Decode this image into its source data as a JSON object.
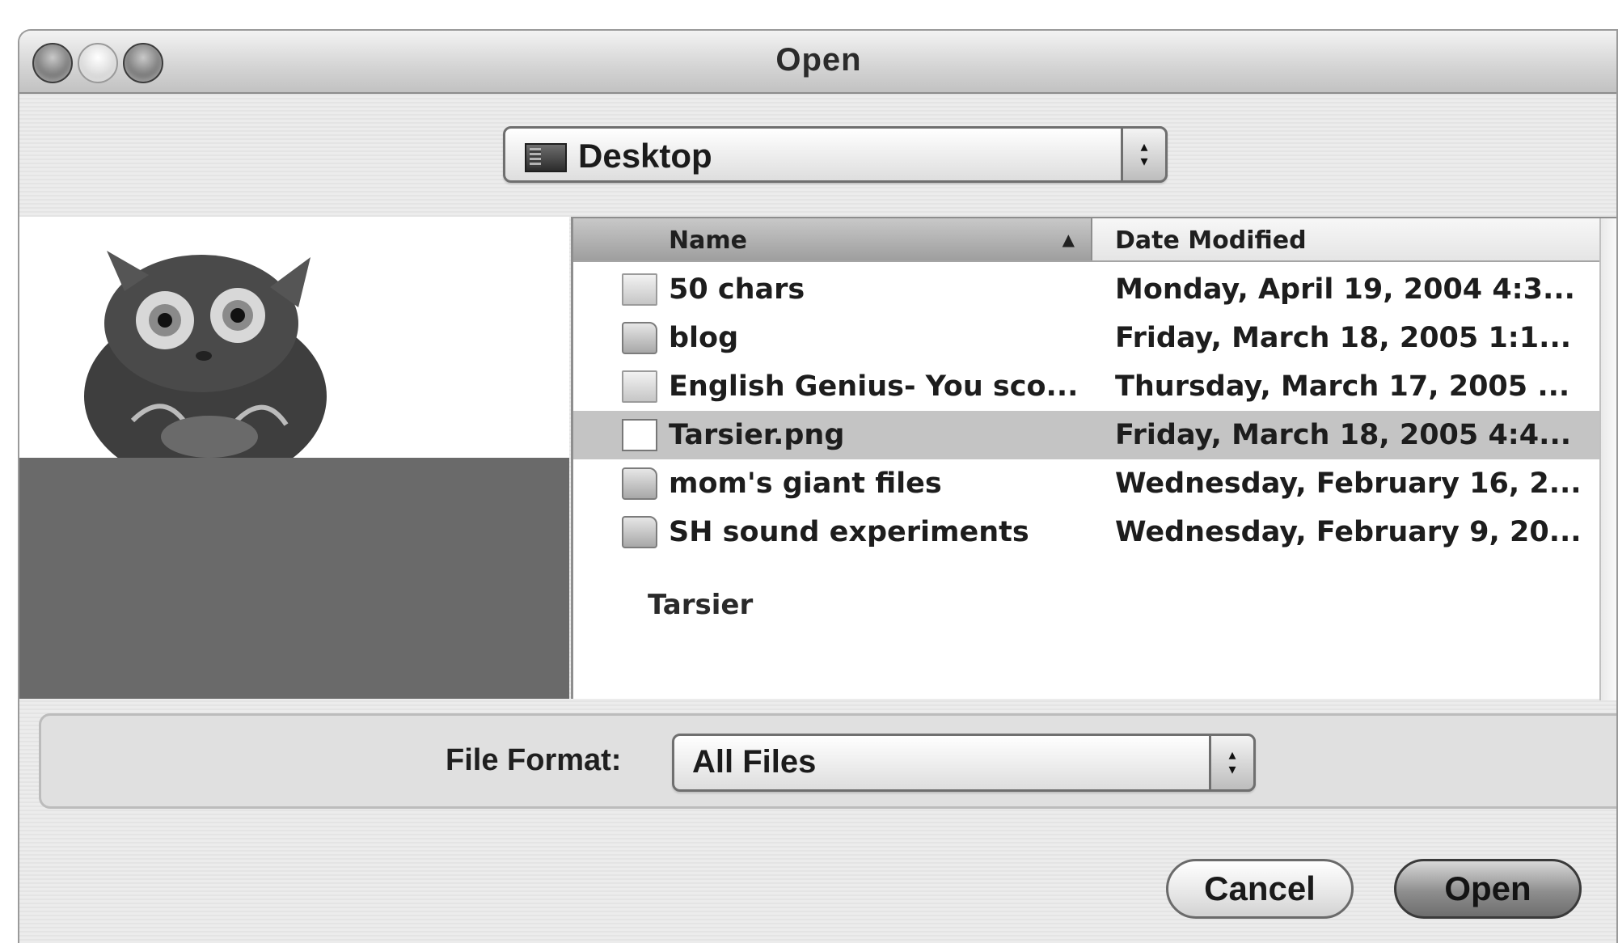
{
  "window": {
    "title": "Open",
    "controls": [
      "close",
      "minimize",
      "zoom"
    ]
  },
  "location": {
    "selected": "Desktop",
    "icon": "desktop-icon"
  },
  "preview": {
    "image": "tarsier-photo",
    "caption": "Tarsier"
  },
  "columns": {
    "name": "Name",
    "date": "Date Modified",
    "sort_indicator": "▲"
  },
  "files": [
    {
      "name": "50 chars",
      "date": "Monday, April 19, 2004 4:3...",
      "icon": "document-icon",
      "selected": false
    },
    {
      "name": "blog",
      "date": "Friday, March 18, 2005 1:1...",
      "icon": "folder-icon",
      "selected": false
    },
    {
      "name": "English Genius- You sco...",
      "date": "Thursday, March 17, 2005 ...",
      "icon": "document-icon",
      "selected": false
    },
    {
      "name": "Tarsier.png",
      "date": "Friday, March 18, 2005 4:4...",
      "icon": "png-file-icon",
      "selected": true
    },
    {
      "name": "mom's giant files",
      "date": "Wednesday, February 16, 2...",
      "icon": "folder-icon",
      "selected": false
    },
    {
      "name": "SH sound experiments",
      "date": "Wednesday, February 9, 20...",
      "icon": "folder-icon",
      "selected": false
    }
  ],
  "format": {
    "label": "File Format:",
    "selected": "All Files"
  },
  "buttons": {
    "cancel": "Cancel",
    "open": "Open"
  }
}
